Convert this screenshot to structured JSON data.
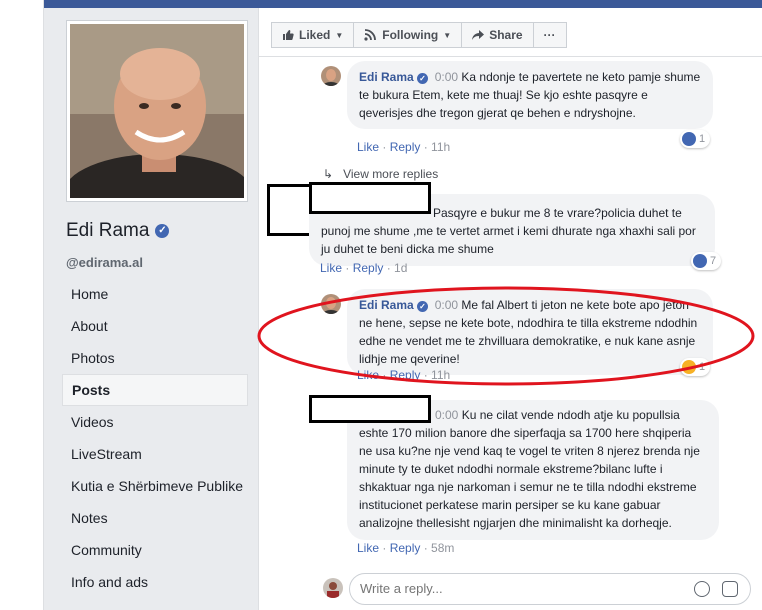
{
  "page": {
    "name": "Edi Rama",
    "handle": "@edirama.al"
  },
  "nav": {
    "items": [
      "Home",
      "About",
      "Photos",
      "Posts",
      "Videos",
      "LiveStream",
      "Kutia e Shërbimeve Publike",
      "Notes",
      "Community",
      "Info and ads"
    ],
    "active_index": 3
  },
  "actions": {
    "liked": "Liked",
    "following": "Following",
    "share": "Share",
    "more": "···"
  },
  "comments": [
    {
      "author": "Edi Rama",
      "time": "0:00",
      "text": "Ka ndonje te pavertete ne keto pamje shume te bukura Etem, kete me thuaj! Se kjo eshte pasqyre e qeverisjes dhe tregon gjerat qe behen e ndryshojne.",
      "like": "Like",
      "reply": "Reply",
      "age": "11h",
      "reactions": "1"
    },
    {
      "text": "Pasqyre e bukur me 8 te vrare?policia duhet te punoj me shume ,me te vertet armet i kemi dhurate nga xhaxhi sali por ju duhet te beni dicka me shume",
      "like": "Like",
      "reply": "Reply",
      "age": "1d",
      "reactions": "7"
    },
    {
      "author": "Edi Rama",
      "time": "0:00",
      "text": "Me fal Albert ti jeton ne kete bote apo jeton ne hene, sepse ne kete bote, ndodhira te tilla ekstreme ndodhin edhe ne vendet me te zhvilluara demokratike, e nuk kane asnje lidhje me qeverine!",
      "like": "Like",
      "reply": "Reply",
      "age": "11h",
      "reactions": "1"
    },
    {
      "time": "0:00",
      "text": "Ku ne cilat vende ndodh atje ku popullsia eshte 170 milion banore dhe siperfaqja sa 1700 here shqiperia ne usa ku?ne nje vend kaq te vogel te vriten 8 njerez brenda nje minute ty te duket ndodhi normale ekstreme?bilanc lufte i shkaktuar nga nje narkoman i semur ne te tilla ndodhi ekstreme institucionet perkatese marin persiper se ku kane gabuar analizojne thellesisht ngjarjen dhe minimalisht ka dorheqje.",
      "like": "Like",
      "reply": "Reply",
      "age": "58m"
    }
  ],
  "view_more": "View more replies",
  "reply_box": {
    "placeholder": "Write a reply..."
  },
  "colors": {
    "brand": "#3b5998",
    "link": "#385898",
    "annotation": "#e0141e"
  }
}
